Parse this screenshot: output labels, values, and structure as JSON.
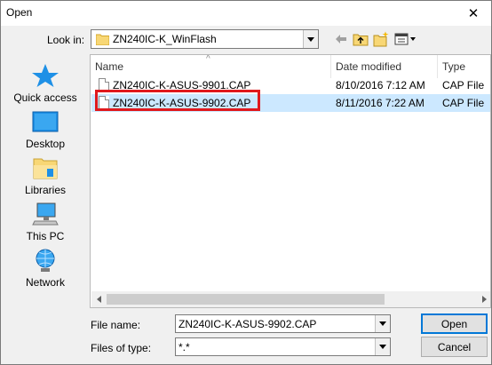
{
  "window": {
    "title": "Open",
    "close_glyph": "✕"
  },
  "toolbar": {
    "look_in_label": "Look in:",
    "look_in_value": "ZN240IC-K_WinFlash",
    "icons": [
      "back-arrow-icon",
      "up-folder-icon",
      "new-folder-icon",
      "view-menu-icon"
    ]
  },
  "places": [
    {
      "label": "Quick access",
      "icon": "star-icon"
    },
    {
      "label": "Desktop",
      "icon": "desktop-icon"
    },
    {
      "label": "Libraries",
      "icon": "libraries-icon"
    },
    {
      "label": "This PC",
      "icon": "computer-icon"
    },
    {
      "label": "Network",
      "icon": "network-icon"
    }
  ],
  "file_list": {
    "columns": [
      "Name",
      "Date modified",
      "Type"
    ],
    "rows": [
      {
        "name": "ZN240IC-K-ASUS-9901.CAP",
        "date": "8/10/2016 7:12 AM",
        "type": "CAP File",
        "selected": false
      },
      {
        "name": "ZN240IC-K-ASUS-9902.CAP",
        "date": "8/11/2016 7:22 AM",
        "type": "CAP File",
        "selected": true
      }
    ],
    "highlight_color": "#e0191d",
    "selection_color": "#cce8ff"
  },
  "bottom": {
    "file_name_label": "File name:",
    "file_name_value": "ZN240IC-K-ASUS-9902.CAP",
    "files_of_type_label": "Files of type:",
    "files_of_type_value": "*.*",
    "open_button": "Open",
    "cancel_button": "Cancel"
  },
  "colors": {
    "accent": "#0078d7"
  }
}
